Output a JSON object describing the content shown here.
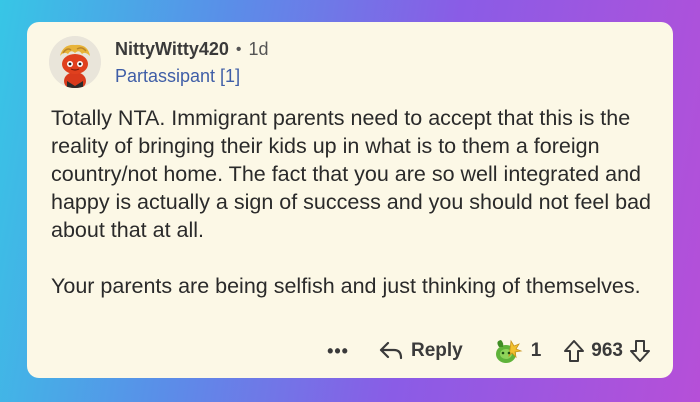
{
  "comment": {
    "username": "NittyWitty420",
    "separator": "•",
    "age": "1d",
    "flair": "Partassipant [1]",
    "paragraphs": [
      "Totally NTA. Immigrant parents need to accept that this is the reality of bringing their kids up in what is to them a foreign country/not home. The fact that you are so well integrated and happy is actually a sign of success and you should not feel bad about that at all.",
      "Your parents are being selfish and just thinking of themselves."
    ]
  },
  "actions": {
    "more_label": "•••",
    "reply_label": "Reply",
    "award_count": "1",
    "vote_count": "963"
  },
  "icons": {
    "avatar": "snoo-avatar-icon",
    "more": "more-options-icon",
    "reply": "reply-arrow-icon",
    "award": "award-icon",
    "upvote": "upvote-arrow-icon",
    "downvote": "downvote-arrow-icon"
  }
}
